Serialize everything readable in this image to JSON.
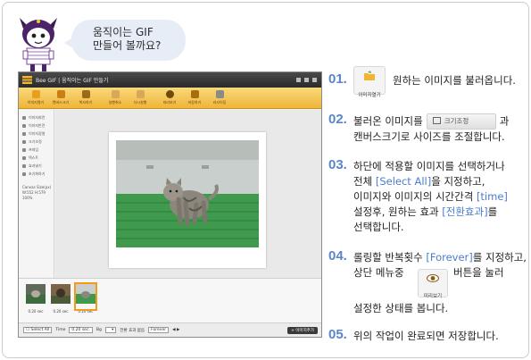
{
  "bubble": {
    "line1": "움직이는 GIF",
    "line2": "만들어 볼까요?"
  },
  "app": {
    "title": "Bee GIF | 움직이는 GIF 만들기",
    "toolbar": [
      "이미지열기",
      "캔버스크기",
      "복사하기",
      "실행취소",
      "다시실행",
      "미리보기",
      "저장하기",
      "리사이징"
    ],
    "sidebar": [
      "이미지회전",
      "이미지반전",
      "이미지정렬",
      "크기조정",
      "프레임",
      "텍스트",
      "효과넣기",
      "초기화하기"
    ],
    "canvas_size_label": "Canvas Size(px)",
    "canvas_w": "W:552",
    "canvas_h": "H:579",
    "zoom": "100%",
    "thumb_captions": [
      "0.20 sec",
      "0.20 sec",
      "0.20 sec"
    ],
    "bottom": {
      "select_all": "Select All",
      "time_label": "Time",
      "time_value": "0.20 sec.",
      "bg_label": "Bg",
      "effect": "전환 효과 없음",
      "repeat": "Forever",
      "add_button": "+ 이미지추가"
    }
  },
  "icon_open_label": "이미지열기",
  "icon_preview_label": "미리보기",
  "crop_button_label": "크기조정",
  "steps": [
    {
      "num": "01.",
      "text_after": "원하는 이미지를 불러옵니다."
    },
    {
      "num": "02.",
      "text_a": "불러온 이미지를",
      "text_b": "과",
      "line2": "캔버스크기로 사이즈를 조절합니다."
    },
    {
      "num": "03.",
      "line1": "하단에 적용할 이미지를 선택하거나",
      "l2a": "전체 ",
      "l2h": "[Select All]",
      "l2b": "을 지정하고,",
      "l3a": "이미지와 이미지의 시간간격 ",
      "l3h": "[time]",
      "l4a": "설정후, 원하는 효과 ",
      "l4h": "[전환효과]",
      "l4b": "를",
      "line5": "선택합니다."
    },
    {
      "num": "04.",
      "l1a": "롤링할 반복횟수 ",
      "l1h": "[Forever]",
      "l1b": "를 지정하고,",
      "l2a": "상단 메뉴중",
      "l2b": "버튼을 눌러",
      "line3": "설정한 상태를 봅니다."
    },
    {
      "num": "05.",
      "text": "위의 작업이 완료되면 저장합니다."
    }
  ]
}
